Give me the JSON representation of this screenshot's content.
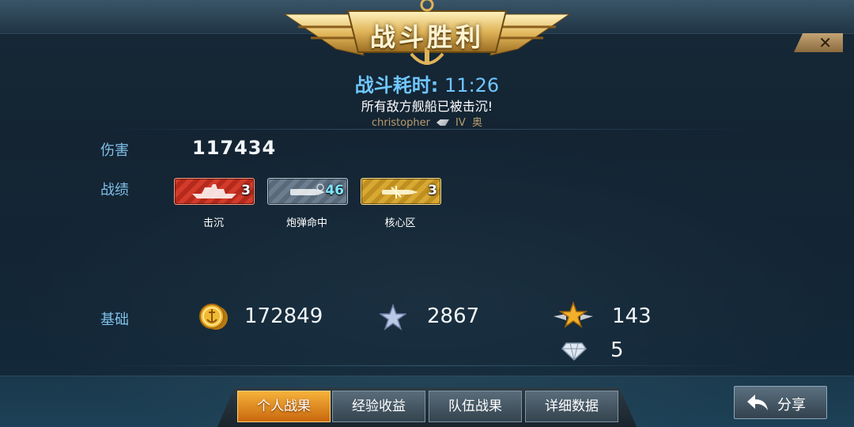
{
  "header": {
    "title": "战斗胜利",
    "close_label": "✕"
  },
  "battle": {
    "duration_label": "战斗耗时:",
    "duration_value": "11:26",
    "result_text": "所有敌方舰船已被击沉!",
    "player_name": "christopher",
    "player_tier": "IV",
    "player_ship_class": "奥"
  },
  "damage": {
    "label": "伤害",
    "value": "117434"
  },
  "achievements": {
    "label": "战绩",
    "items": [
      {
        "count": "3",
        "caption": "击沉",
        "color": "#d33b2a",
        "icon": "ship-silhouette-icon"
      },
      {
        "count": "46",
        "caption": "炮弹命中",
        "color": "#6b7d8f",
        "icon": "shell-icon"
      },
      {
        "count": "3",
        "caption": "核心区",
        "color": "#d8a932",
        "icon": "gold-shell-icon"
      }
    ]
  },
  "base": {
    "label": "基础",
    "credits": {
      "value": "172849",
      "icon": "gold-coin-icon"
    },
    "experience": {
      "value": "2867",
      "icon": "silver-star-icon"
    },
    "commander_xp": {
      "value": "143",
      "icon": "gold-winged-star-icon"
    },
    "diamonds": {
      "value": "5",
      "icon": "diamond-icon"
    }
  },
  "tabs": [
    {
      "label": "个人战果",
      "active": true
    },
    {
      "label": "经验收益",
      "active": false
    },
    {
      "label": "队伍战果",
      "active": false
    },
    {
      "label": "详细数据",
      "active": false
    }
  ],
  "share": {
    "label": "分享",
    "icon": "back-arrow-icon"
  },
  "colors": {
    "accent_blue": "#6fc6ff",
    "label_blue": "#7fc0e8",
    "gold": "#d8a932"
  }
}
